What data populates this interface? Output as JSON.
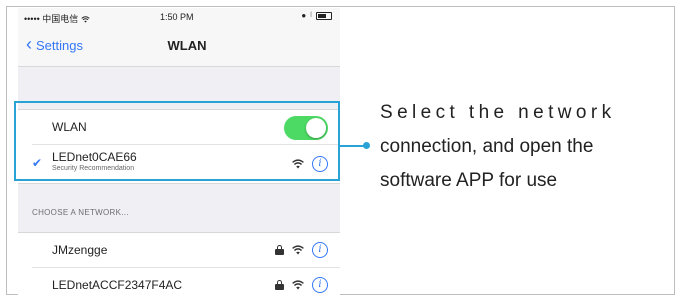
{
  "status_bar": {
    "carrier": "••••• 中国电信 ",
    "time": "1:50 PM"
  },
  "nav": {
    "back_label": "Settings",
    "title": "WLAN"
  },
  "wlan_group": {
    "toggle_label": "WLAN",
    "toggle_on": true,
    "connected_network": {
      "name": "LEDnet0CAE66",
      "subtitle": "Security Recommendation"
    }
  },
  "section_header": "CHOOSE A NETWORK...",
  "networks": [
    {
      "name": "JMzengge"
    },
    {
      "name": "LEDnetACCF2347F4AC"
    }
  ],
  "caption": {
    "line1": "Select the network",
    "line2": "connection, and open the",
    "line3": "software APP for use"
  },
  "colors": {
    "accent_blue": "#3478f6",
    "toggle_green": "#4cd964",
    "highlight_border": "#29a3d6"
  }
}
